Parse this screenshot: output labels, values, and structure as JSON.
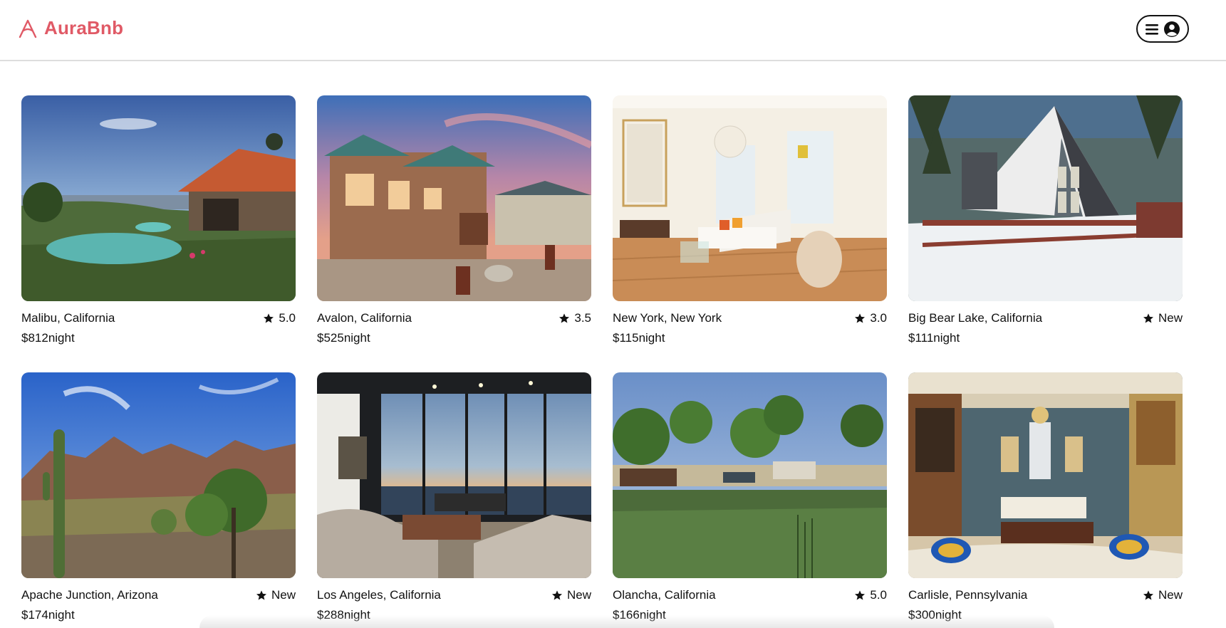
{
  "brand": {
    "name": "AuraBnb",
    "color": "#e05a66",
    "logo_icon": "airbnb-logo-icon"
  },
  "header": {
    "menu_icon": "hamburger-menu-icon",
    "user_icon": "user-avatar-icon"
  },
  "listings": [
    {
      "location": "Malibu, California",
      "rating": "5.0",
      "price": "$812",
      "unit": "night",
      "photo": "villa-pool-ocean-view"
    },
    {
      "location": "Avalon, California",
      "rating": "3.5",
      "price": "$525",
      "unit": "night",
      "photo": "stone-mansion-sunset"
    },
    {
      "location": "New York, New York",
      "rating": "3.0",
      "price": "$115",
      "unit": "night",
      "photo": "bright-living-room"
    },
    {
      "location": "Big Bear Lake, California",
      "rating": "New",
      "price": "$111",
      "unit": "night",
      "photo": "snowy-a-frame-cabin"
    },
    {
      "location": "Apache Junction, Arizona",
      "rating": "New",
      "price": "$174",
      "unit": "night",
      "photo": "desert-saguaro-mountains"
    },
    {
      "location": "Los Angeles, California",
      "rating": "New",
      "price": "$288",
      "unit": "night",
      "photo": "modern-living-room-view"
    },
    {
      "location": "Olancha, California",
      "rating": "5.0",
      "price": "$166",
      "unit": "night",
      "photo": "pond-trees-ranch"
    },
    {
      "location": "Carlisle, Pennsylvania",
      "rating": "New",
      "price": "$300",
      "unit": "night",
      "photo": "ornate-victorian-parlor"
    }
  ]
}
